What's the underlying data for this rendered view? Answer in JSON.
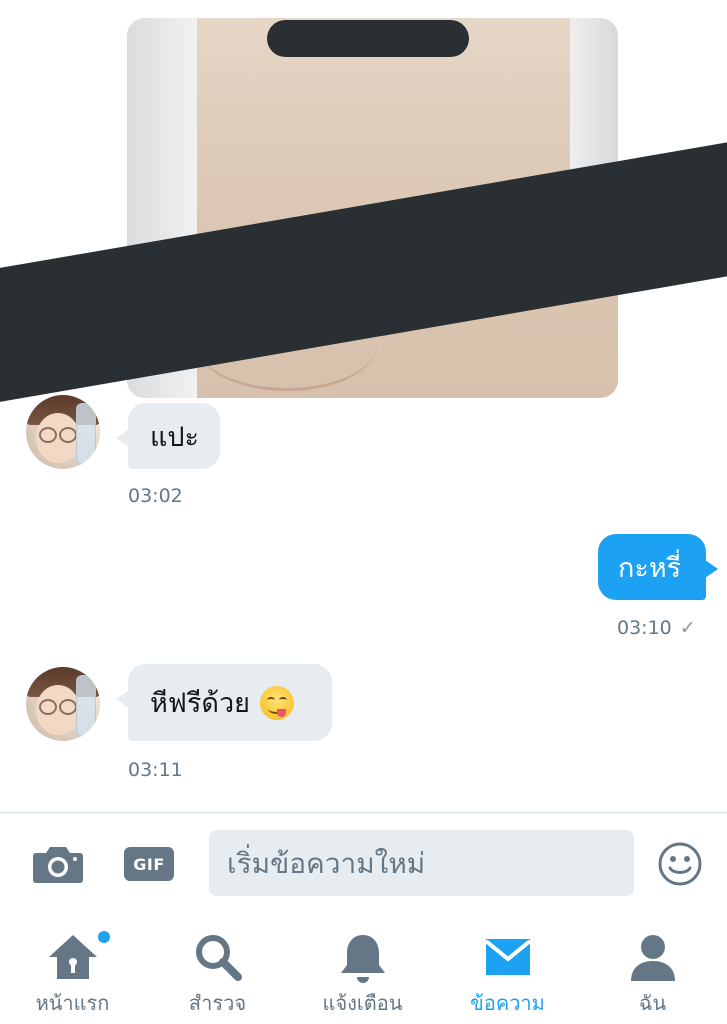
{
  "conversation": {
    "messages": [
      {
        "direction": "incoming",
        "type": "image",
        "censored": true
      },
      {
        "direction": "incoming",
        "text": "แปะ",
        "time": "03:02"
      },
      {
        "direction": "outgoing",
        "text": "กะหรี่",
        "time": "03:10",
        "status": "sent-check"
      },
      {
        "direction": "incoming",
        "text": "หีฟรีด้วย",
        "emoji": "face-savoring-food",
        "time": "03:11"
      }
    ],
    "check_mark": "✓"
  },
  "composer": {
    "camera_icon": "camera-icon",
    "gif_label": "GIF",
    "placeholder": "เริ่มข้อความใหม่",
    "value": "",
    "emoji_icon": "smiley-icon"
  },
  "tabbar": {
    "tabs": [
      {
        "label": "หน้าแรก",
        "icon": "home-icon",
        "active": false,
        "notification_dot": true
      },
      {
        "label": "สำรวจ",
        "icon": "search-icon",
        "active": false
      },
      {
        "label": "แจ้งเตือน",
        "icon": "bell-icon",
        "active": false
      },
      {
        "label": "ข้อความ",
        "icon": "mail-icon",
        "active": true
      },
      {
        "label": "ฉัน",
        "icon": "person-icon",
        "active": false
      }
    ]
  },
  "colors": {
    "accent": "#1da1f2",
    "icon_gray": "#657786",
    "incoming_bubble": "#e6ecf0",
    "censor": "#292f33"
  }
}
